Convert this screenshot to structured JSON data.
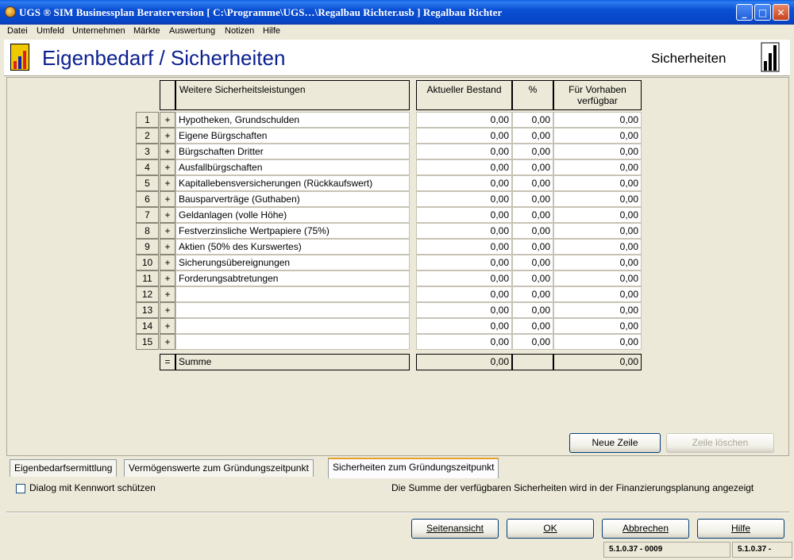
{
  "window": {
    "title": "UGS ® SIM Businessplan Beraterversion   [ C:\\Programme\\UGS…\\Regalbau Richter.usb ] Regalbau Richter"
  },
  "menu": [
    "Datei",
    "Umfeld",
    "Unternehmen",
    "Märkte",
    "Auswertung",
    "Notizen",
    "Hilfe"
  ],
  "header": {
    "title": "Eigenbedarf / Sicherheiten",
    "section": "Sicherheiten"
  },
  "table": {
    "headers": {
      "description": "Weitere Sicherheitsleistungen",
      "current": "Aktueller Bestand",
      "percent": "%",
      "available": "Für Vorhaben verfügbar"
    },
    "rows": [
      {
        "index": "1",
        "op": "+",
        "label": "Hypotheken, Grundschulden",
        "current": "0,00",
        "percent": "0,00",
        "available": "0,00"
      },
      {
        "index": "2",
        "op": "+",
        "label": "Eigene Bürgschaften",
        "current": "0,00",
        "percent": "0,00",
        "available": "0,00"
      },
      {
        "index": "3",
        "op": "+",
        "label": "Bürgschaften Dritter",
        "current": "0,00",
        "percent": "0,00",
        "available": "0,00"
      },
      {
        "index": "4",
        "op": "+",
        "label": "Ausfallbürgschaften",
        "current": "0,00",
        "percent": "0,00",
        "available": "0,00"
      },
      {
        "index": "5",
        "op": "+",
        "label": "Kapitallebensversicherungen (Rückkaufswert)",
        "current": "0,00",
        "percent": "0,00",
        "available": "0,00"
      },
      {
        "index": "6",
        "op": "+",
        "label": "Bausparverträge (Guthaben)",
        "current": "0,00",
        "percent": "0,00",
        "available": "0,00"
      },
      {
        "index": "7",
        "op": "+",
        "label": "Geldanlagen (volle Höhe)",
        "current": "0,00",
        "percent": "0,00",
        "available": "0,00"
      },
      {
        "index": "8",
        "op": "+",
        "label": "Festverzinsliche Wertpapiere (75%)",
        "current": "0,00",
        "percent": "0,00",
        "available": "0,00"
      },
      {
        "index": "9",
        "op": "+",
        "label": "Aktien (50% des Kurswertes)",
        "current": "0,00",
        "percent": "0,00",
        "available": "0,00"
      },
      {
        "index": "10",
        "op": "+",
        "label": "Sicherungsübereignungen",
        "current": "0,00",
        "percent": "0,00",
        "available": "0,00"
      },
      {
        "index": "11",
        "op": "+",
        "label": "Forderungsabtretungen",
        "current": "0,00",
        "percent": "0,00",
        "available": "0,00"
      },
      {
        "index": "12",
        "op": "+",
        "label": "",
        "current": "0,00",
        "percent": "0,00",
        "available": "0,00"
      },
      {
        "index": "13",
        "op": "+",
        "label": "",
        "current": "0,00",
        "percent": "0,00",
        "available": "0,00"
      },
      {
        "index": "14",
        "op": "+",
        "label": "",
        "current": "0,00",
        "percent": "0,00",
        "available": "0,00"
      },
      {
        "index": "15",
        "op": "+",
        "label": "",
        "current": "0,00",
        "percent": "0,00",
        "available": "0,00"
      }
    ],
    "sum": {
      "op": "=",
      "label": "Summe",
      "current": "0,00",
      "available": "0,00"
    }
  },
  "buttons": {
    "new_row": "Neue Zeile",
    "delete_row": "Zeile löschen",
    "page_view": "Seitenansicht",
    "ok": "OK",
    "cancel": "Abbrechen",
    "help": "Hilfe"
  },
  "tabs": [
    {
      "label": "Eigenbedarfsermittlung",
      "active": false
    },
    {
      "label": "Vermögenswerte zum Gründungszeitpunkt",
      "active": false
    },
    {
      "label": "Sicherheiten zum Gründungszeitpunkt",
      "active": true
    }
  ],
  "options": {
    "password_protect": "Dialog mit Kennwort schützen",
    "password_checked": false
  },
  "info_text": "Die Summe der verfügbaren Sicherheiten wird in der Finanzierungsplanung angezeigt",
  "status": {
    "left": "5.1.0.37 - 0009",
    "right": "5.1.0.37 -"
  },
  "colors": {
    "title_blue": "#0a1f8f",
    "titlebar": "#0a4fd4",
    "icon_red": "#e02020",
    "icon_yellow": "#f0c800",
    "icon_blue": "#1020c0"
  }
}
